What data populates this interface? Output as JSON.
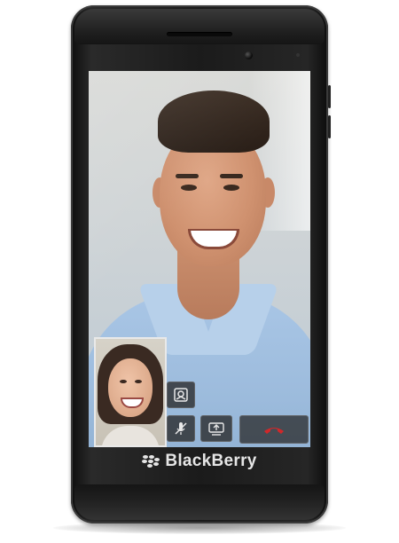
{
  "brand": {
    "name": "BlackBerry",
    "logo_icon": "blackberry-logo-icon"
  },
  "call": {
    "controls": [
      {
        "id": "switch-camera",
        "icon": "switch-camera-icon"
      },
      {
        "id": "mute",
        "icon": "mic-off-icon"
      },
      {
        "id": "share-screen",
        "icon": "share-screen-icon"
      },
      {
        "id": "end-call",
        "icon": "end-call-icon"
      }
    ]
  },
  "colors": {
    "phone_body": "#1b1b1b",
    "end_call_accent": "#d0282a",
    "brand_text": "#e6e6e6"
  }
}
